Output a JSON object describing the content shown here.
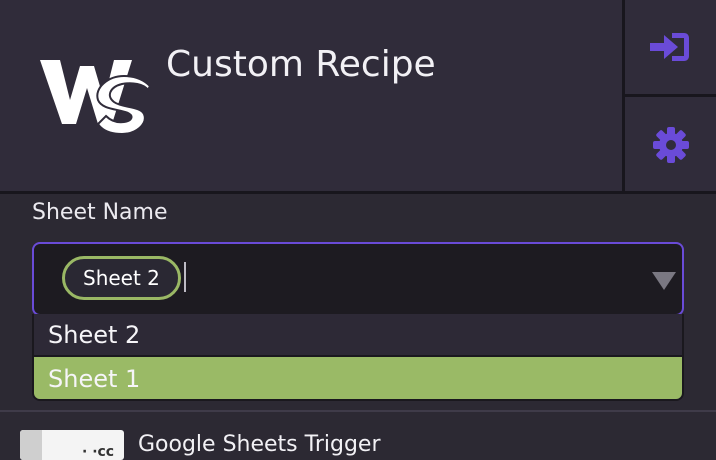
{
  "app": {
    "title": "Custom Recipe",
    "logo": "WS"
  },
  "header_actions": [
    {
      "icon": "login-icon",
      "color": "#6a4bd8"
    },
    {
      "icon": "gear-icon",
      "color": "#6a4bd8"
    }
  ],
  "sheet_field": {
    "label": "Sheet Name",
    "selected_chip": "Sheet 2",
    "options": [
      {
        "label": "Sheet 2",
        "highlighted": false
      },
      {
        "label": "Sheet 1",
        "highlighted": true
      }
    ]
  },
  "trigger": {
    "title": "Google Sheets Trigger"
  },
  "colors": {
    "accent": "#6a4bd8",
    "highlight": "#9aba66",
    "background": "#2c2933"
  }
}
